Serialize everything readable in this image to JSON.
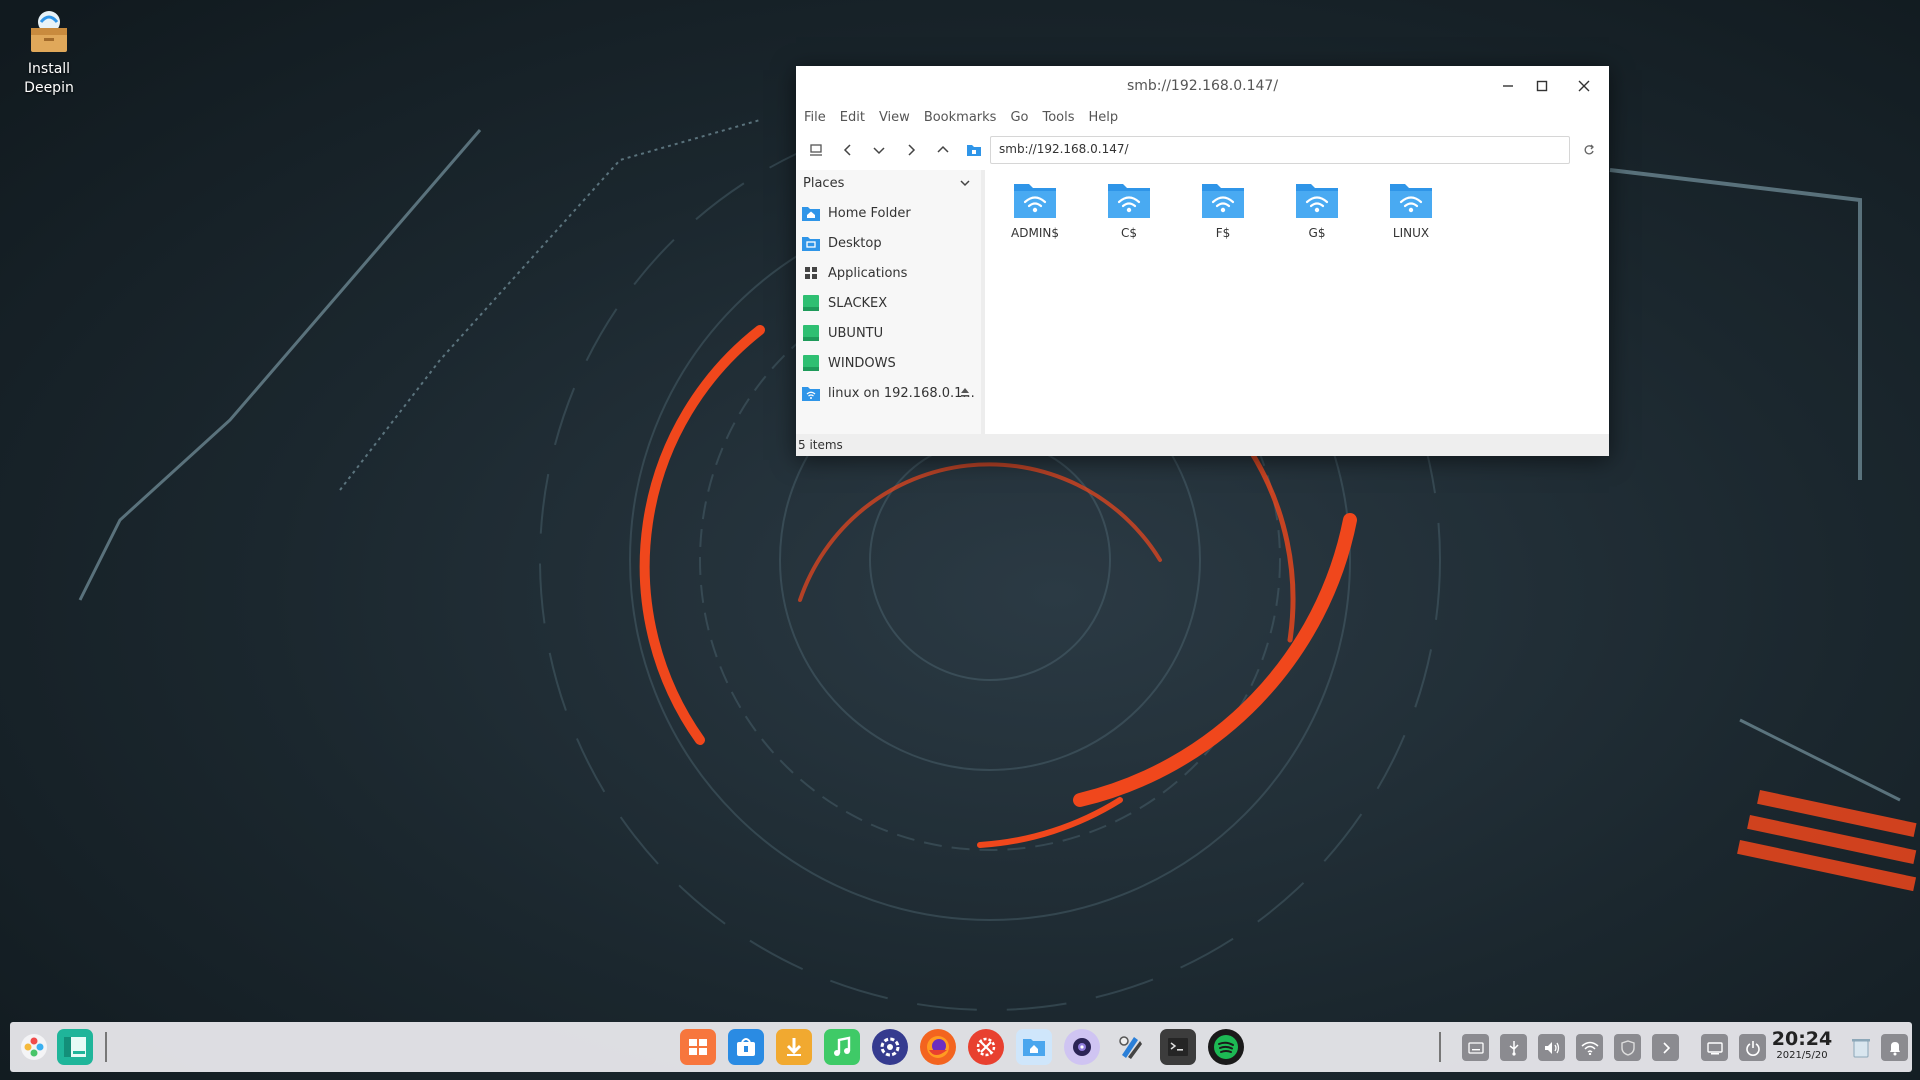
{
  "desktop": {
    "icons": [
      {
        "label": "Install Deepin",
        "icon": "package-box-icon"
      }
    ]
  },
  "window": {
    "title": "smb://192.168.0.147/",
    "menu": [
      "File",
      "Edit",
      "View",
      "Bookmarks",
      "Go",
      "Tools",
      "Help"
    ],
    "address": "smb://192.168.0.147/",
    "sidebar": {
      "heading": "Places",
      "items": [
        {
          "label": "Home Folder",
          "icon": "home-folder-icon"
        },
        {
          "label": "Desktop",
          "icon": "desktop-folder-icon"
        },
        {
          "label": "Applications",
          "icon": "applications-grid-icon"
        },
        {
          "label": "SLACKEX",
          "icon": "drive-icon"
        },
        {
          "label": "UBUNTU",
          "icon": "drive-icon"
        },
        {
          "label": "WINDOWS",
          "icon": "drive-icon"
        },
        {
          "label": "linux on 192.168.0.1...",
          "icon": "network-share-icon"
        }
      ]
    },
    "items": [
      "ADMIN$",
      "C$",
      "F$",
      "G$",
      "LINUX"
    ],
    "status": "5 items"
  },
  "taskbar": {
    "clock_time": "20:24",
    "clock_date": "2021/5/20",
    "apps": [
      "launcher-icon",
      "file-manager-dock-icon",
      "app-store-icon",
      "bag-app-icon",
      "download-icon",
      "music-icon",
      "settings-gear-icon",
      "firefox-icon",
      "tools-icon",
      "files-folder-icon",
      "camera-icon",
      "scripts-icon",
      "terminal-icon",
      "spotify-icon"
    ],
    "tray": [
      "keyboard-icon",
      "usb-icon",
      "volume-icon",
      "wifi-icon",
      "shield-icon",
      "expand-icon",
      "display-icon",
      "power-icon",
      "trash-icon",
      "notification-icon"
    ]
  },
  "colors": {
    "folder_blue": "#2f95e8",
    "drive_green": "#2fbf72",
    "accent_orange": "#f0471c"
  }
}
